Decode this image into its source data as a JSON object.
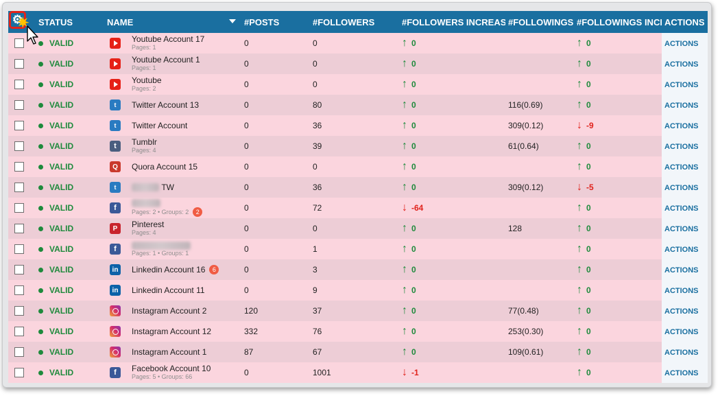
{
  "header": {
    "gear_icon": "gear-icon",
    "columns": [
      "STATUS",
      "NAME",
      "#POSTS",
      "#FOLLOWERS",
      "#FOLLOWERS INCREASE",
      "#FOLLOWINGS",
      "#FOLLOWINGS INCREASE",
      "ACTIONS"
    ],
    "gear_glyph": "⚙"
  },
  "rows": [
    {
      "status": "VALID",
      "service": "youtube",
      "name": "Youtube Account 17",
      "sub": "Pages: 1",
      "posts": "0",
      "followers": "0",
      "fol_inc": {
        "dir": "up",
        "val": "0"
      },
      "followings": "",
      "fing_inc": {
        "dir": "up",
        "val": "0"
      },
      "action": "ACTIONS"
    },
    {
      "status": "VALID",
      "service": "youtube",
      "name": "Youtube Account 1",
      "sub": "Pages: 1",
      "posts": "0",
      "followers": "0",
      "fol_inc": {
        "dir": "up",
        "val": "0"
      },
      "followings": "",
      "fing_inc": {
        "dir": "up",
        "val": "0"
      },
      "action": "ACTIONS"
    },
    {
      "status": "VALID",
      "service": "youtube",
      "name": "Youtube",
      "sub": "Pages: 2",
      "posts": "0",
      "followers": "0",
      "fol_inc": {
        "dir": "up",
        "val": "0"
      },
      "followings": "",
      "fing_inc": {
        "dir": "up",
        "val": "0"
      },
      "action": "ACTIONS"
    },
    {
      "status": "VALID",
      "service": "twitter",
      "name": "Twitter Account 13",
      "sub": "",
      "posts": "0",
      "followers": "80",
      "fol_inc": {
        "dir": "up",
        "val": "0"
      },
      "followings": "116(0.69)",
      "fing_inc": {
        "dir": "up",
        "val": "0"
      },
      "action": "ACTIONS"
    },
    {
      "status": "VALID",
      "service": "twitter",
      "name": "Twitter Account",
      "sub": "",
      "posts": "0",
      "followers": "36",
      "fol_inc": {
        "dir": "up",
        "val": "0"
      },
      "followings": "309(0.12)",
      "fing_inc": {
        "dir": "down",
        "val": "-9"
      },
      "action": "ACTIONS"
    },
    {
      "status": "VALID",
      "service": "tumblr",
      "name": "Tumblr",
      "sub": "Pages: 4",
      "posts": "0",
      "followers": "39",
      "fol_inc": {
        "dir": "up",
        "val": "0"
      },
      "followings": "61(0.64)",
      "fing_inc": {
        "dir": "up",
        "val": "0"
      },
      "action": "ACTIONS"
    },
    {
      "status": "VALID",
      "service": "quora",
      "name": "Quora Account 15",
      "sub": "",
      "posts": "0",
      "followers": "0",
      "fol_inc": {
        "dir": "up",
        "val": "0"
      },
      "followings": "",
      "fing_inc": {
        "dir": "up",
        "val": "0"
      },
      "action": "ACTIONS"
    },
    {
      "status": "VALID",
      "service": "twitter",
      "name": "TW",
      "blur": true,
      "blurw": 40,
      "sub": "",
      "posts": "0",
      "followers": "36",
      "fol_inc": {
        "dir": "up",
        "val": "0"
      },
      "followings": "309(0.12)",
      "fing_inc": {
        "dir": "down",
        "val": "-5"
      },
      "action": "ACTIONS"
    },
    {
      "status": "VALID",
      "service": "facebook",
      "name": "",
      "blur": true,
      "blurw": 42,
      "sub": "Pages: 2 • Groups: 2",
      "badge": "2",
      "posts": "0",
      "followers": "72",
      "fol_inc": {
        "dir": "down",
        "val": "-64"
      },
      "followings": "",
      "fing_inc": {
        "dir": "up",
        "val": "0"
      },
      "action": "ACTIONS"
    },
    {
      "status": "VALID",
      "service": "pinterest",
      "name": "Pinterest",
      "sub": "Pages: 4",
      "posts": "0",
      "followers": "0",
      "fol_inc": {
        "dir": "up",
        "val": "0"
      },
      "followings": "128",
      "fing_inc": {
        "dir": "up",
        "val": "0"
      },
      "action": "ACTIONS"
    },
    {
      "status": "VALID",
      "service": "facebook",
      "name": "",
      "blur": true,
      "blurw": 86,
      "sub": "Pages: 1 • Groups: 1",
      "posts": "0",
      "followers": "1",
      "fol_inc": {
        "dir": "up",
        "val": "0"
      },
      "followings": "",
      "fing_inc": {
        "dir": "up",
        "val": "0"
      },
      "action": "ACTIONS"
    },
    {
      "status": "VALID",
      "service": "linkedin",
      "name": "Linkedin Account 16",
      "sub": "",
      "badge": "6",
      "posts": "0",
      "followers": "3",
      "fol_inc": {
        "dir": "up",
        "val": "0"
      },
      "followings": "",
      "fing_inc": {
        "dir": "up",
        "val": "0"
      },
      "action": "ACTIONS"
    },
    {
      "status": "VALID",
      "service": "linkedin",
      "name": "Linkedin Account 11",
      "sub": "",
      "posts": "0",
      "followers": "9",
      "fol_inc": {
        "dir": "up",
        "val": "0"
      },
      "followings": "",
      "fing_inc": {
        "dir": "up",
        "val": "0"
      },
      "action": "ACTIONS"
    },
    {
      "status": "VALID",
      "service": "instagram",
      "name": "Instagram Account 2",
      "sub": "",
      "posts": "120",
      "followers": "37",
      "fol_inc": {
        "dir": "up",
        "val": "0"
      },
      "followings": "77(0.48)",
      "fing_inc": {
        "dir": "up",
        "val": "0"
      },
      "action": "ACTIONS"
    },
    {
      "status": "VALID",
      "service": "instagram",
      "name": "Instagram Account 12",
      "sub": "",
      "posts": "332",
      "followers": "76",
      "fol_inc": {
        "dir": "up",
        "val": "0"
      },
      "followings": "253(0.30)",
      "fing_inc": {
        "dir": "up",
        "val": "0"
      },
      "action": "ACTIONS"
    },
    {
      "status": "VALID",
      "service": "instagram",
      "name": "Instagram Account 1",
      "sub": "",
      "posts": "87",
      "followers": "67",
      "fol_inc": {
        "dir": "up",
        "val": "0"
      },
      "followings": "109(0.61)",
      "fing_inc": {
        "dir": "up",
        "val": "0"
      },
      "action": "ACTIONS"
    },
    {
      "status": "VALID",
      "service": "facebook",
      "name": "Facebook Account 10",
      "sub": "Pages: 5 • Groups: 66",
      "posts": "0",
      "followers": "1001",
      "fol_inc": {
        "dir": "down",
        "val": "-1"
      },
      "followings": "",
      "fing_inc": {
        "dir": "up",
        "val": "0"
      },
      "action": "ACTIONS"
    }
  ],
  "icons": {
    "youtube": "",
    "twitter": "t",
    "tumblr": "t",
    "quora": "Q",
    "facebook": "f",
    "pinterest": "P",
    "linkedin": "in",
    "instagram": ""
  },
  "colors": {
    "header": "#1a6fa0",
    "row_odd": "#fbd5de",
    "row_even": "#edcdd6",
    "valid": "#1e8a3c",
    "up": "#1e8a3c",
    "down": "#e0231c",
    "highlight": "#e2231a"
  }
}
